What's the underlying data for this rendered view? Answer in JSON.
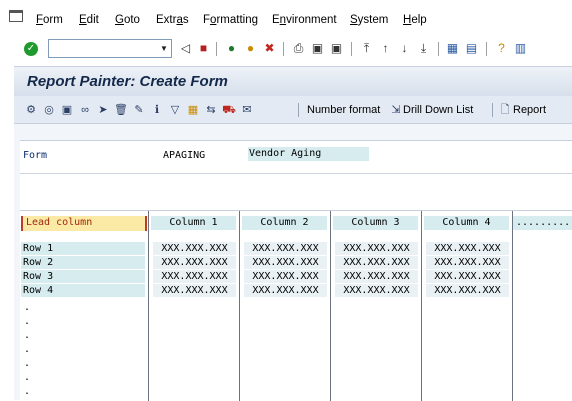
{
  "menu": {
    "items": [
      {
        "label": "Form",
        "u": "F",
        "rest": "orm"
      },
      {
        "label": "Edit",
        "u": "E",
        "rest": "dit"
      },
      {
        "label": "Goto",
        "u": "G",
        "rest": "oto"
      },
      {
        "label": "Extras",
        "pre": "Extr",
        "u": "a",
        "rest": "s"
      },
      {
        "label": "Formatting",
        "pre": "F",
        "u": "o",
        "rest": "rmatting"
      },
      {
        "label": "Environment",
        "pre": "E",
        "u": "n",
        "rest": "vironment"
      },
      {
        "label": "System",
        "u": "S",
        "rest": "ystem"
      },
      {
        "label": "Help",
        "u": "H",
        "rest": "elp"
      }
    ]
  },
  "toolbar": {
    "command_value": "",
    "icons": [
      "enter-icon",
      "back-icon",
      "save-icon",
      "back-nav-icon",
      "exit-icon",
      "cancel-icon",
      "print-icon",
      "find-icon",
      "find-next-icon",
      "first-page-icon",
      "prev-page-icon",
      "next-page-icon",
      "last-page-icon",
      "new-session-icon",
      "shortcut-icon",
      "help-icon",
      "layout-icon"
    ]
  },
  "title": "Report Painter: Create Form",
  "app_toolbar": {
    "number_format": "Number format",
    "drill_down": "Drill Down List",
    "report": "Report"
  },
  "form": {
    "label": "Form",
    "code": "APAGING",
    "description": "Vendor Aging"
  },
  "grid": {
    "lead_column": "Lead column",
    "columns": [
      "Column 1",
      "Column 2",
      "Column 3",
      "Column 4"
    ],
    "more_columns": ".........",
    "rows": [
      "Row 1",
      "Row 2",
      "Row 3",
      "Row 4"
    ],
    "cell_value": "XXX.XXX.XXX",
    "dots": [
      ".",
      ".",
      ".",
      ".",
      ".",
      ".",
      "."
    ]
  },
  "colors": {
    "title_text": "#14294a",
    "lead_column_bg": "#fbe9a6",
    "lead_column_border": "#c0392b",
    "cell_bg": "#d6ecef"
  }
}
